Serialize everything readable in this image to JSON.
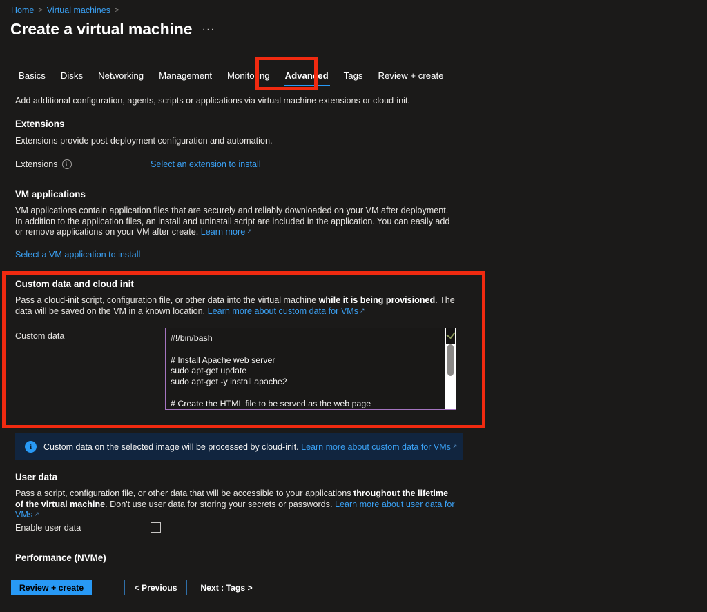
{
  "breadcrumb": {
    "items": [
      {
        "label": "Home",
        "separator": ">"
      },
      {
        "label": "Virtual machines",
        "separator": ">"
      }
    ]
  },
  "header": {
    "title": "Create a virtual machine",
    "ellipsis": "···"
  },
  "tabs": [
    {
      "label": "Basics",
      "active": false
    },
    {
      "label": "Disks",
      "active": false
    },
    {
      "label": "Networking",
      "active": false
    },
    {
      "label": "Management",
      "active": false
    },
    {
      "label": "Monitoring",
      "active": false
    },
    {
      "label": "Advanced",
      "active": true
    },
    {
      "label": "Tags",
      "active": false
    },
    {
      "label": "Review + create",
      "active": false
    }
  ],
  "intro": "Add additional configuration, agents, scripts or applications via virtual machine extensions or cloud-init.",
  "extensions": {
    "heading": "Extensions",
    "description": "Extensions provide post-deployment configuration and automation.",
    "field_label": "Extensions",
    "info_glyph": "i",
    "action_link": "Select an extension to install"
  },
  "vm_applications": {
    "heading": "VM applications",
    "description_part1": "VM applications contain application files that are securely and reliably downloaded on your VM after deployment. In addition to the application files, an install and uninstall script are included in the application. You can easily add or remove applications on your VM after create. ",
    "learn_more": "Learn more",
    "external_glyph": "↗",
    "action_link": "Select a VM application to install"
  },
  "custom_data": {
    "heading": "Custom data and cloud init",
    "description_part1": "Pass a cloud-init script, configuration file, or other data into the virtual machine ",
    "description_bold": "while it is being provisioned",
    "description_part2": ". The data will be saved on the VM in a known location. ",
    "learn_more": "Learn more about custom data for VMs",
    "external_glyph": "↗",
    "field_label": "Custom data",
    "textarea_value": "#!/bin/bash\n\n# Install Apache web server\nsudo apt-get update\nsudo apt-get -y install apache2\n\n# Create the HTML file to be served as the web page",
    "textarea_placeholder": "",
    "border_color": "#a474c0"
  },
  "info_banner": {
    "icon": "info-icon",
    "text": "Custom data on the selected image will be processed by cloud-init. ",
    "link": "Learn more about custom data for VMs",
    "external_glyph": "↗",
    "background": "#11253f"
  },
  "user_data": {
    "heading": "User data",
    "description_part1": "Pass a script, configuration file, or other data that will be accessible to your applications ",
    "description_bold": "throughout the lifetime of the virtual machine",
    "description_part2": ". Don't use user data for storing your secrets or passwords. ",
    "learn_more": "Learn more about user data for VMs",
    "external_glyph": "↗",
    "checkbox_label": "Enable user data",
    "checkbox_checked": false
  },
  "performance": {
    "heading": "Performance (NVMe)"
  },
  "footer": {
    "review_create": "Review + create",
    "previous": "< Previous",
    "next": "Next : Tags >"
  },
  "highlights": {
    "color": "#f02a10",
    "regions": [
      "advanced-tab",
      "custom-data-section"
    ]
  },
  "theme": {
    "background": "#1b1a19",
    "accent": "#2899f5",
    "link": "#3aa0f3",
    "highlight_red": "#f02a10"
  }
}
